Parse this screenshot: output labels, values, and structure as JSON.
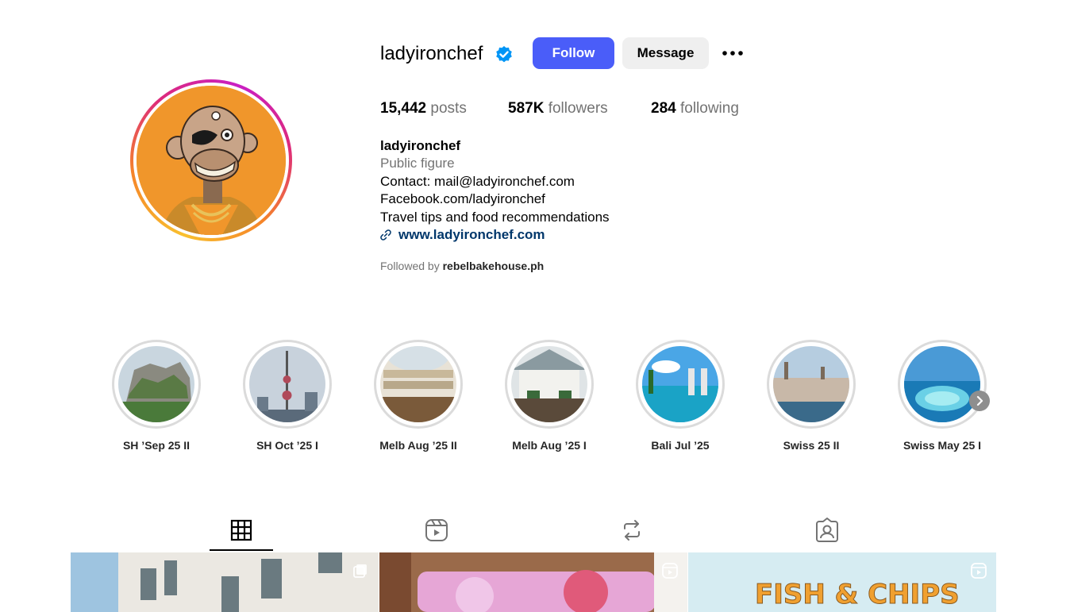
{
  "profile": {
    "username": "ladyironchef",
    "follow_label": "Follow",
    "message_label": "Message",
    "more_icon": "more-horizontal-icon",
    "verified_icon": "verified-badge-icon"
  },
  "stats": {
    "posts_count": "15,442",
    "posts_label": "posts",
    "followers_count": "587K",
    "followers_label": "followers",
    "following_count": "284",
    "following_label": "following"
  },
  "bio": {
    "name": "ladyironchef",
    "category": "Public figure",
    "lines": [
      "Contact: mail@ladyironchef.com",
      "Facebook.com/ladyironchef",
      "Travel tips and food recommendations"
    ],
    "link": "www.ladyironchef.com",
    "followed_by_prefix": "Followed by",
    "followed_by_user": "rebelbakehouse.ph"
  },
  "highlights": [
    {
      "label": "SH ’Sep 25 II"
    },
    {
      "label": "SH Oct ’25 I"
    },
    {
      "label": "Melb Aug ’25 II"
    },
    {
      "label": "Melb Aug ’25 I"
    },
    {
      "label": "Bali Jul ’25"
    },
    {
      "label": "Swiss 25 II"
    },
    {
      "label": "Swiss May 25 I"
    }
  ],
  "tabs": [
    "posts-grid-icon",
    "reels-icon",
    "reposts-icon",
    "tagged-icon"
  ],
  "colors": {
    "accent": "#4a5df9",
    "link": "#00376b",
    "muted": "#737373",
    "avatar_bg": "#f0962b"
  }
}
